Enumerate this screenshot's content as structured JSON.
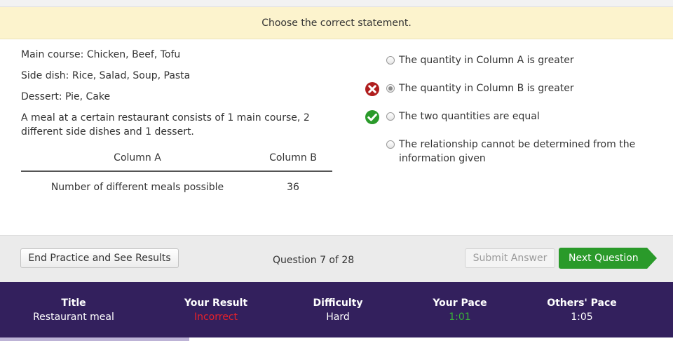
{
  "prompt": "Choose the correct statement.",
  "problem": {
    "info_lines": [
      "Main course: Chicken, Beef, Tofu",
      "Side dish: Rice, Salad, Soup, Pasta",
      "Dessert: Pie, Cake"
    ],
    "question": "A meal at a certain restaurant consists of 1 main course, 2 different side dishes and 1 dessert.",
    "table": {
      "headers": [
        "Column A",
        "Column B"
      ],
      "row": [
        "Number of different meals possible",
        "36"
      ]
    }
  },
  "options": [
    {
      "label": "The quantity in Column A is greater",
      "selected": false,
      "mark": "none"
    },
    {
      "label": "The quantity in Column B is greater",
      "selected": true,
      "mark": "incorrect-x-icon"
    },
    {
      "label": "The two quantities are equal",
      "selected": false,
      "mark": "correct-check-icon"
    },
    {
      "label": "The relationship cannot be determined from the information given",
      "selected": false,
      "mark": "none"
    }
  ],
  "actions": {
    "end_label": "End Practice and See Results",
    "counter": "Question 7 of 28",
    "submit_label": "Submit Answer",
    "next_label": "Next Question"
  },
  "stats": {
    "title_label": "Title",
    "title_value": "Restaurant meal",
    "result_label": "Your Result",
    "result_value": "Incorrect",
    "difficulty_label": "Difficulty",
    "difficulty_value": "Hard",
    "pace_label": "Your Pace",
    "pace_value": "1:01",
    "others_label": "Others' Pace",
    "others_value": "1:05"
  },
  "colors": {
    "prompt_bg": "#fcf3cd",
    "stats_bg": "#33205d",
    "next_green": "#2a9a2a",
    "incorrect_red": "#e8212a",
    "pace_green": "#38b138",
    "x_icon": "#b01e1e",
    "check_icon": "#2a9a2a"
  }
}
